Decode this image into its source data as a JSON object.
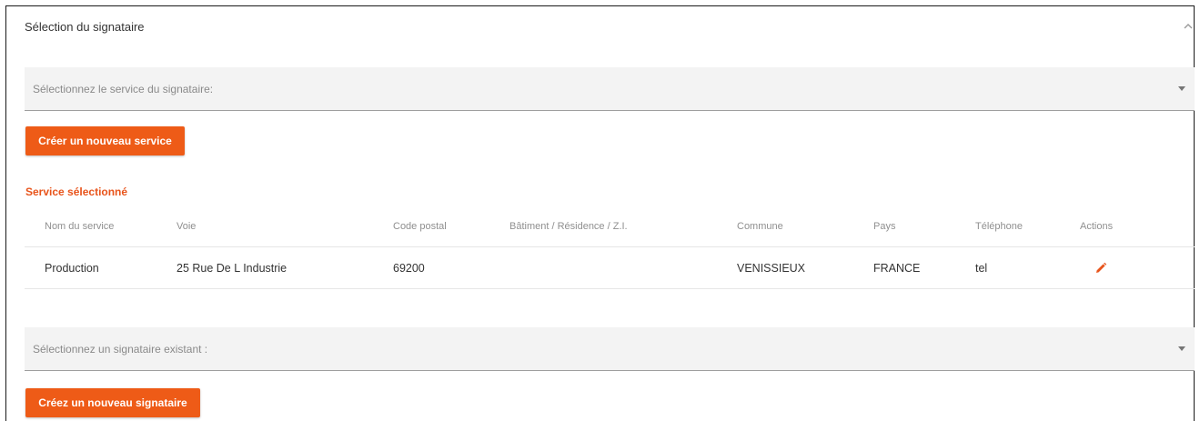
{
  "panel": {
    "title": "Sélection du signataire",
    "collapse_icon": "chevron-up-icon"
  },
  "service_select": {
    "placeholder": "Sélectionnez le service du signataire:"
  },
  "new_service_button": {
    "label": "Créer un nouveau service"
  },
  "selected_service": {
    "title": "Service sélectionné",
    "columns": [
      "Nom du service",
      "Voie",
      "Code postal",
      "Bâtiment / Résidence / Z.I.",
      "Commune",
      "Pays",
      "Téléphone",
      "Actions"
    ],
    "rows": [
      {
        "nom": "Production",
        "voie": "25 Rue De L Industrie",
        "code_postal": "69200",
        "batiment": "",
        "commune": "VENISSIEUX",
        "pays": "FRANCE",
        "telephone": "tel",
        "action_icon": "pencil-icon"
      }
    ]
  },
  "signataire_select": {
    "placeholder": "Sélectionnez un signataire existant :"
  },
  "new_signataire_button": {
    "label": "Créez un nouveau signataire"
  },
  "colors": {
    "accent": "#ee5b17",
    "accent_text": "#e8541b",
    "select_bg": "#f3f3f3"
  }
}
